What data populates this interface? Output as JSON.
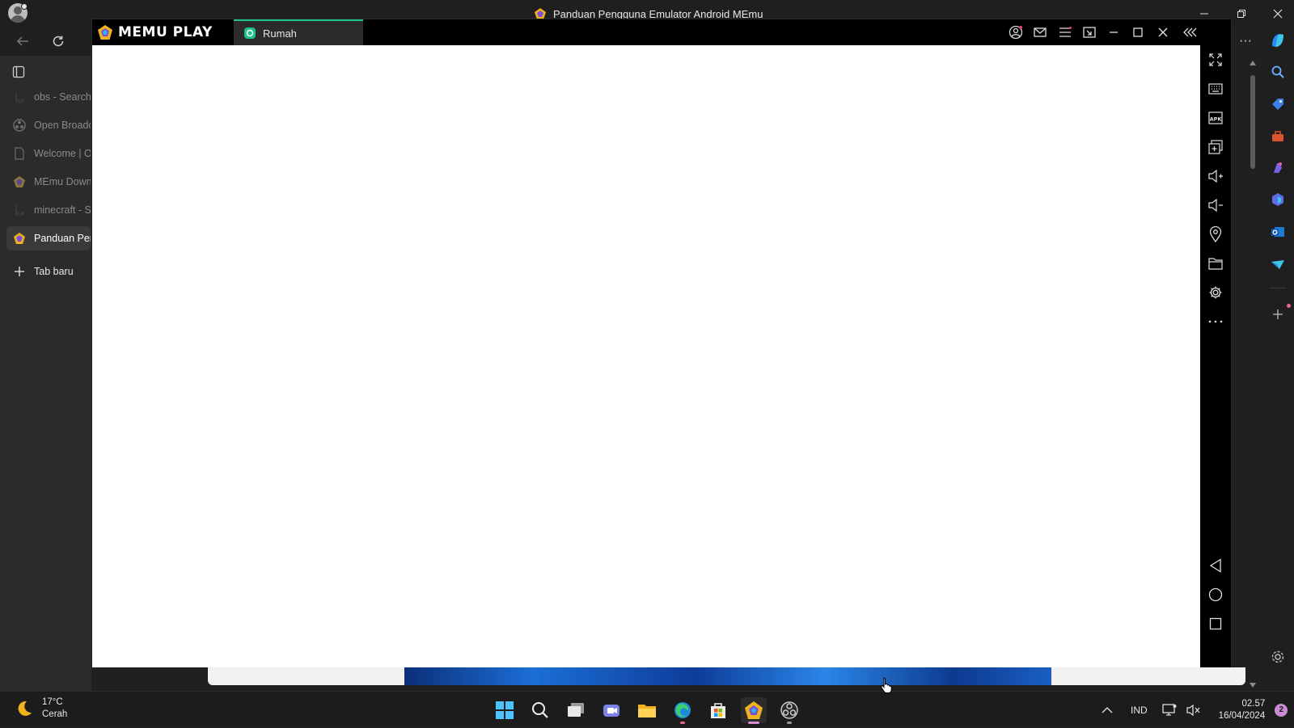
{
  "browser": {
    "window_title": "Panduan Pengguna Emulator Android MEmu",
    "tabs": [
      {
        "label": "obs - Search",
        "icon": "bing-icon",
        "active": false
      },
      {
        "label": "Open Broadcaster Software",
        "icon": "obs-icon",
        "active": false
      },
      {
        "label": "Welcome | OBS",
        "icon": "page-icon",
        "active": false
      },
      {
        "label": "MEmu Download",
        "icon": "memu-icon",
        "active": false
      },
      {
        "label": "minecraft - Search",
        "icon": "bing-icon",
        "active": false
      },
      {
        "label": "Panduan Pengguna",
        "icon": "memu-icon",
        "active": true
      }
    ],
    "new_tab_label": "Tab baru",
    "more_menu": "···"
  },
  "memu": {
    "logo_text": "MEMU PLAY",
    "tab_label": "Rumah",
    "accent": "#1ec28b"
  },
  "taskbar": {
    "weather_temp": "17°C",
    "weather_desc": "Cerah",
    "language": "IND",
    "time": "02.57",
    "date": "16/04/2024",
    "notification_count": "2"
  }
}
